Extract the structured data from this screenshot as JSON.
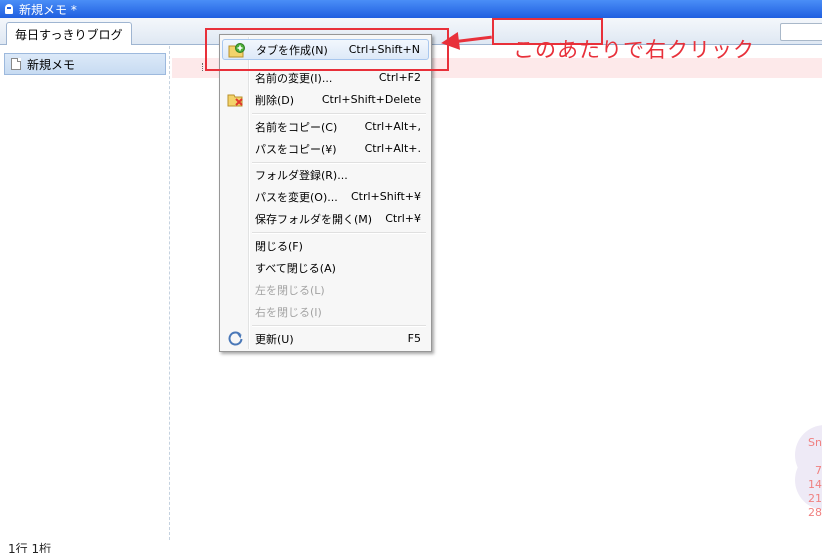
{
  "window": {
    "title": "新規メモ *"
  },
  "tabs": [
    {
      "label": "毎日すっきりブログ"
    }
  ],
  "sidebar": {
    "items": [
      {
        "label": "新規メモ"
      }
    ]
  },
  "status": {
    "position": "1行 1桁"
  },
  "calendar": {
    "header": "Sn",
    "days": [
      "7",
      "14",
      "21",
      "28"
    ]
  },
  "context_menu": {
    "items": [
      {
        "label": "タブを作成(N)",
        "shortcut": "Ctrl+Shift+N",
        "icon": "new-tab-icon"
      },
      {
        "label": "名前の変更(I)...",
        "shortcut": "Ctrl+F2"
      },
      {
        "label": "削除(D)",
        "shortcut": "Ctrl+Shift+Delete",
        "icon": "delete-folder-icon"
      },
      {
        "label": "名前をコピー(C)",
        "shortcut": "Ctrl+Alt+,"
      },
      {
        "label": "パスをコピー(¥)",
        "shortcut": "Ctrl+Alt+."
      },
      {
        "label": "フォルダ登録(R)..."
      },
      {
        "label": "パスを変更(O)...",
        "shortcut": "Ctrl+Shift+¥"
      },
      {
        "label": "保存フォルダを開く(M)",
        "shortcut": "Ctrl+¥"
      },
      {
        "label": "閉じる(F)"
      },
      {
        "label": "すべて閉じる(A)"
      },
      {
        "label": "左を閉じる(L)"
      },
      {
        "label": "右を閉じる(I)"
      },
      {
        "label": "更新(U)",
        "shortcut": "F5",
        "icon": "refresh-icon"
      }
    ]
  },
  "annotation": {
    "text": "このあたりで右クリック",
    "color": "#e8303a"
  },
  "colors": {
    "titlebar": "#1f5fe0",
    "highlight": "#dde9f8",
    "annotation": "#e8303a"
  }
}
